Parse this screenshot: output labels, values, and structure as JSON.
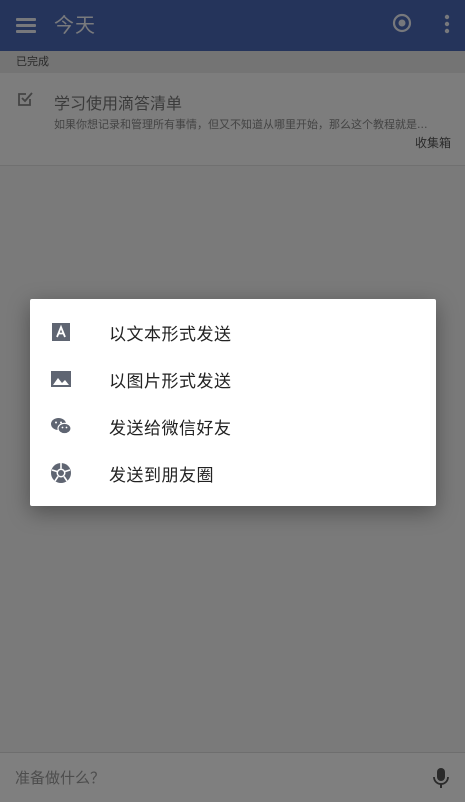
{
  "appbar": {
    "title": "今天",
    "menu_icon": "hamburger-menu-icon",
    "target_icon": "target-icon",
    "more_icon": "more-vert-icon",
    "color": "#4a68b6"
  },
  "section": {
    "label": "已完成"
  },
  "task": {
    "title": "学习使用滴答清单",
    "description": "如果你想记录和管理所有事情，但又不知道从哪里开始，那么这个教程就是...",
    "list_name": "收集箱",
    "check_icon": "checked-box-icon"
  },
  "bottom": {
    "placeholder": "准备做什么？",
    "mic_icon": "microphone-icon"
  },
  "share_dialog": {
    "items": [
      {
        "label": "以文本形式发送",
        "icon": "text-icon"
      },
      {
        "label": "以图片形式发送",
        "icon": "image-icon"
      },
      {
        "label": "发送给微信好友",
        "icon": "wechat-icon"
      },
      {
        "label": "发送到朋友圈",
        "icon": "moments-icon"
      }
    ]
  }
}
